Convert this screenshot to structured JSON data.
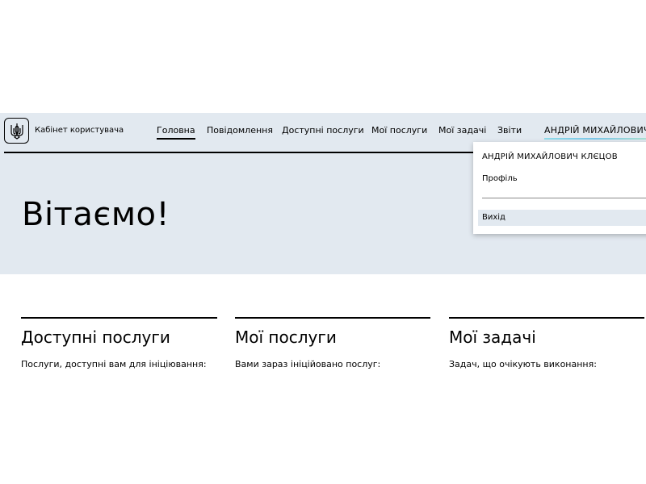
{
  "header": {
    "cabinet_title": "Кабінет користувача",
    "nav": [
      {
        "label": "Головна"
      },
      {
        "label": "Повідомлення"
      },
      {
        "label": "Доступні послуги"
      },
      {
        "label": "Мої послуги"
      },
      {
        "label": "Мої задачі"
      },
      {
        "label": "Звіти"
      }
    ],
    "user_name": "АНДРІЙ МИХАЙЛОВИЧ К..."
  },
  "user_menu": {
    "full_name": "АНДРІЙ МИХАЙЛОВИЧ КЛЄЦОВ",
    "profile_label": "Профіль",
    "logout_label": "Вихід"
  },
  "hero": {
    "title": "Вітаємо!"
  },
  "cards": [
    {
      "title": "Доступні послуги",
      "description": "Послуги, доступні вам для ініціювання:"
    },
    {
      "title": "Мої послуги",
      "description": "Вами зараз ініційовано послуг:"
    },
    {
      "title": "Мої задачі",
      "description": "Задач, що очікують виконання:"
    }
  ],
  "colors": {
    "header_bg": "#e2e9f0",
    "hero_bg": "#e2e9f0",
    "text": "#000000"
  }
}
